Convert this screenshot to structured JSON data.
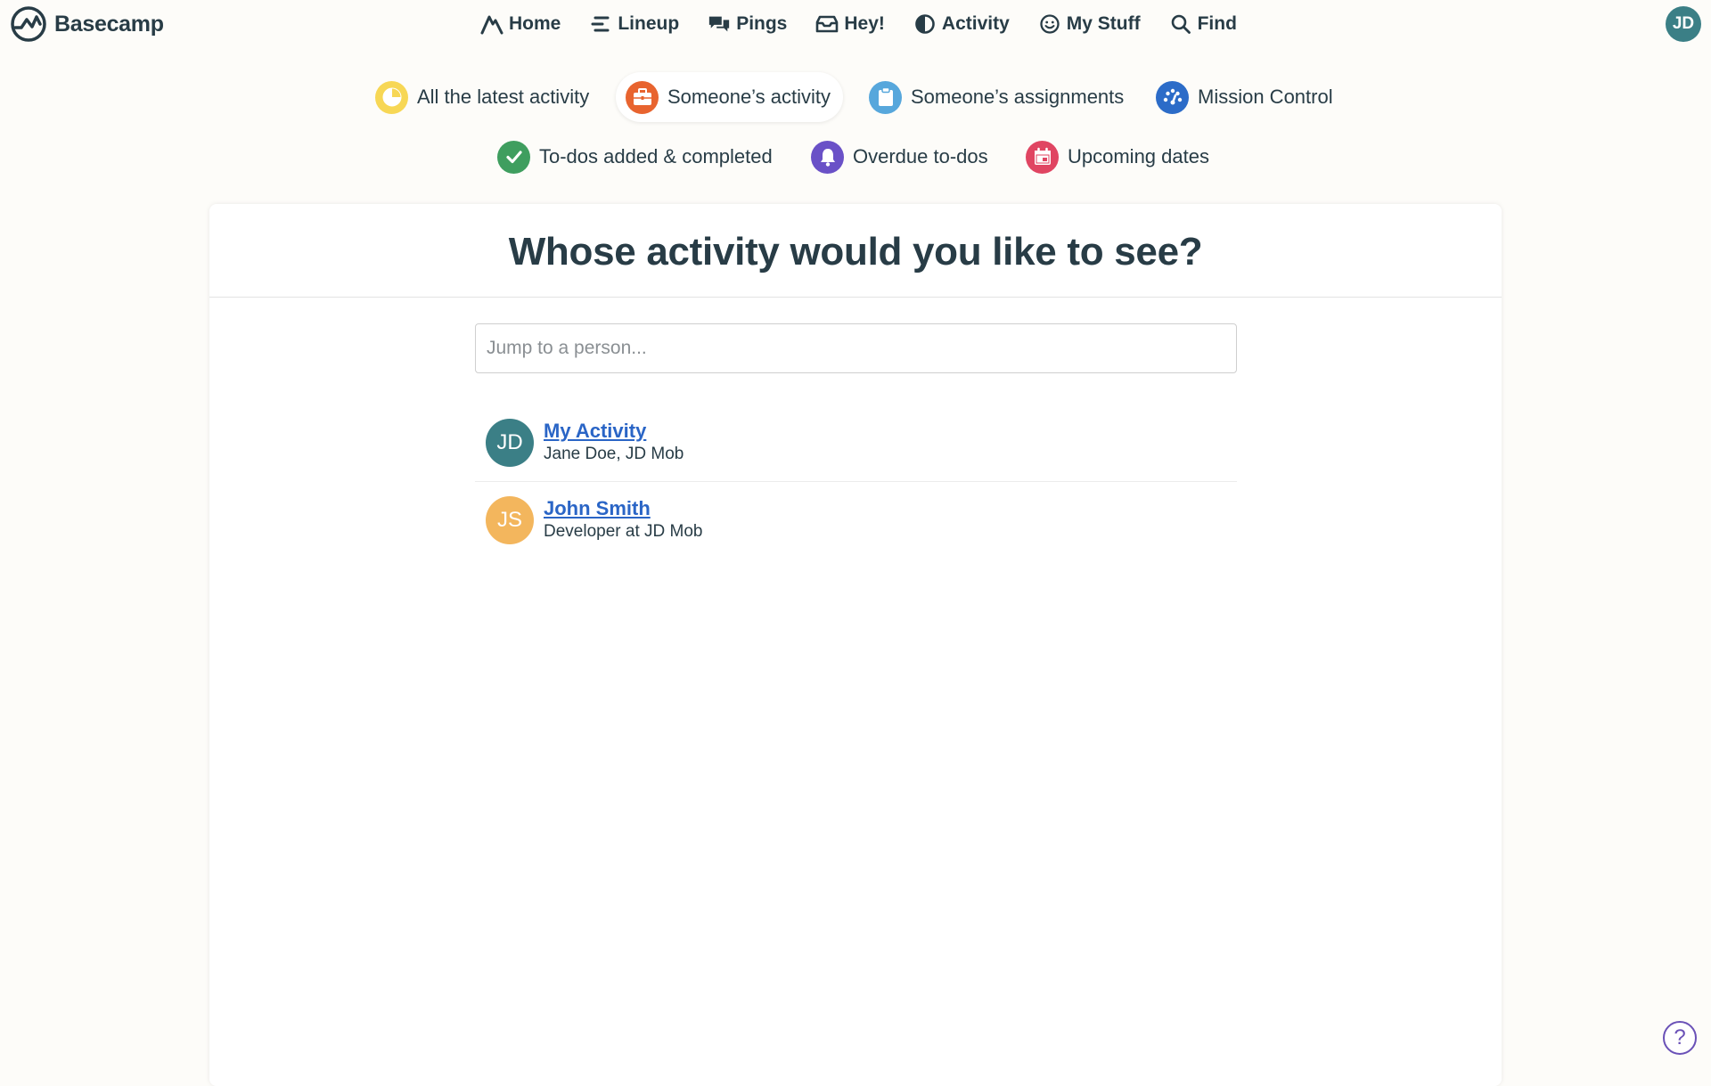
{
  "app": {
    "name": "Basecamp"
  },
  "nav": {
    "items": [
      {
        "label": "Home",
        "icon": "home-icon"
      },
      {
        "label": "Lineup",
        "icon": "lineup-icon"
      },
      {
        "label": "Pings",
        "icon": "pings-icon"
      },
      {
        "label": "Hey!",
        "icon": "hey-inbox-icon"
      },
      {
        "label": "Activity",
        "icon": "activity-icon"
      },
      {
        "label": "My Stuff",
        "icon": "smiley-icon"
      },
      {
        "label": "Find",
        "icon": "search-icon"
      }
    ],
    "user_initials": "JD"
  },
  "report_tabs": [
    {
      "label": "All the latest activity",
      "icon": "clock-icon",
      "color": "#f7d755",
      "active": false
    },
    {
      "label": "Someone’s activity",
      "icon": "briefcase-icon",
      "color": "#e8642f",
      "active": true
    },
    {
      "label": "Someone’s assignments",
      "icon": "clipboard-icon",
      "color": "#57a7dc",
      "active": false
    },
    {
      "label": "Mission Control",
      "icon": "gauge-icon",
      "color": "#2c6cc8",
      "active": false
    },
    {
      "label": "To-dos added & completed",
      "icon": "checkmark-icon",
      "color": "#3f9e5f",
      "active": false
    },
    {
      "label": "Overdue to-dos",
      "icon": "bell-icon",
      "color": "#6a51c7",
      "active": false
    },
    {
      "label": "Upcoming dates",
      "icon": "calendar-icon",
      "color": "#e04562",
      "active": false
    }
  ],
  "main": {
    "title": "Whose activity would you like to see?",
    "search_placeholder": "Jump to a person...",
    "people": [
      {
        "initials": "JD",
        "name": "My Activity",
        "subtitle": "Jane Doe, JD Mob",
        "avatar_color": "#3b7f86"
      },
      {
        "initials": "JS",
        "name": "John Smith",
        "subtitle": "Developer at JD Mob",
        "avatar_color": "#f3b65d"
      }
    ]
  },
  "help": {
    "label": "?"
  }
}
